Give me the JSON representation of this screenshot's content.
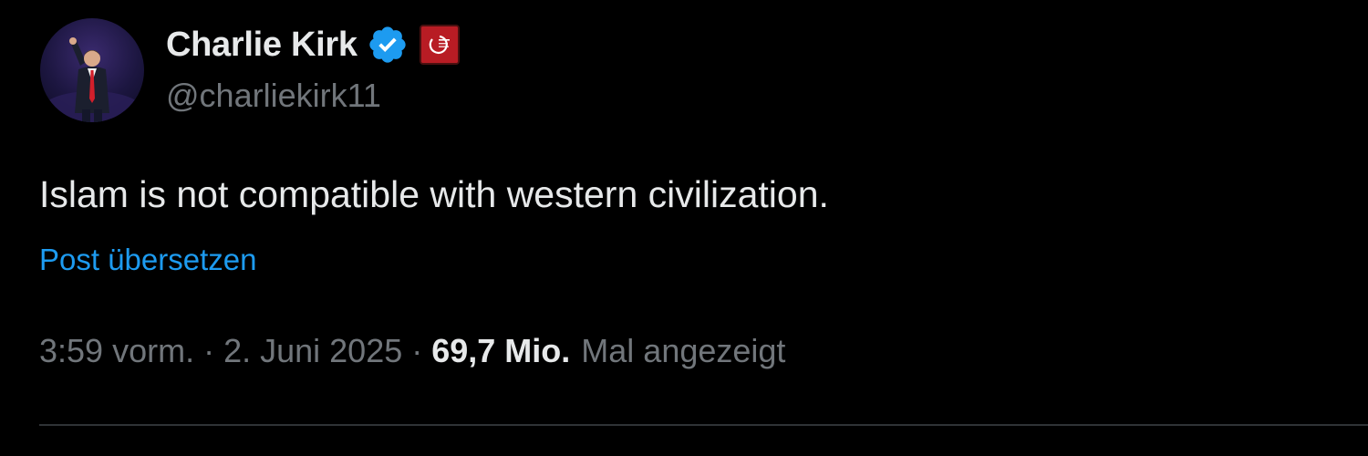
{
  "author": {
    "display_name": "Charlie Kirk",
    "handle": "@charliekirk11",
    "verified_icon": "verified-badge-icon",
    "affiliation_icon": "affiliate-org-logo-icon"
  },
  "post": {
    "text": "Islam is not compatible with western civilization.",
    "translate_label": "Post übersetzen"
  },
  "meta": {
    "time": "3:59 vorm.",
    "separator": "·",
    "date": "2. Juni 2025",
    "views_count": "69,7 Mio.",
    "views_label": "Mal angezeigt"
  },
  "colors": {
    "background": "#000000",
    "primary_text": "#e7e9ea",
    "secondary_text": "#71767b",
    "link": "#1d9bf0",
    "verified": "#1d9bf0",
    "affiliate_badge": "#b81c24",
    "divider": "#2f3336"
  }
}
